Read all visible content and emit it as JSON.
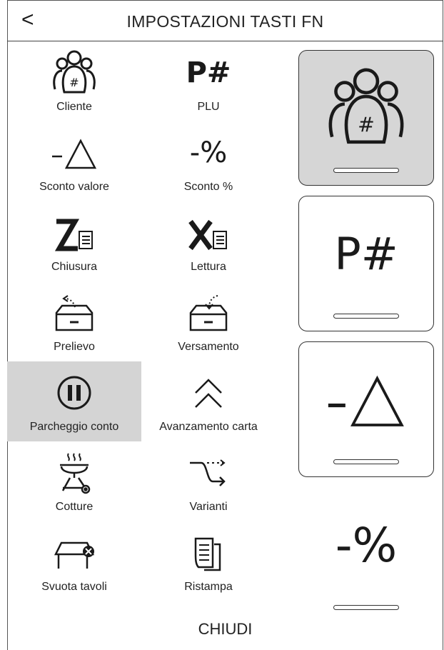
{
  "header": {
    "back_label": "<",
    "title": "IMPOSTAZIONI TASTI FN"
  },
  "functions": [
    {
      "label": "Cliente",
      "icon": "customer-group-icon"
    },
    {
      "label": "PLU",
      "icon": "plu-icon",
      "glyph": "P#"
    },
    {
      "label": "Sconto valore",
      "icon": "discount-value-icon"
    },
    {
      "label": "Sconto %",
      "icon": "discount-percent-icon",
      "glyph": "-%"
    },
    {
      "label": "Chiusura",
      "icon": "z-report-icon"
    },
    {
      "label": "Lettura",
      "icon": "x-report-icon"
    },
    {
      "label": "Prelievo",
      "icon": "withdraw-drawer-icon"
    },
    {
      "label": "Versamento",
      "icon": "deposit-drawer-icon"
    },
    {
      "label": "Parcheggio conto",
      "icon": "pause-icon",
      "selected": true
    },
    {
      "label": "Avanzamento carta",
      "icon": "paper-feed-icon"
    },
    {
      "label": "Cotture",
      "icon": "grill-icon"
    },
    {
      "label": "Varianti",
      "icon": "variants-icon"
    },
    {
      "label": "Svuota tavoli",
      "icon": "clear-table-icon"
    },
    {
      "label": "Ristampa",
      "icon": "reprint-icon"
    }
  ],
  "slots": [
    {
      "icon": "customer-group-icon",
      "active": true
    },
    {
      "icon": "plu-icon",
      "glyph": "P#"
    },
    {
      "icon": "discount-value-icon"
    },
    {
      "icon": "discount-percent-icon",
      "glyph": "-%"
    }
  ],
  "footer": {
    "close_label": "CHIUDI"
  },
  "colors": {
    "selected_bg": "#d4d4d4",
    "active_slot_bg": "#d6d6d6",
    "border": "#333333"
  }
}
